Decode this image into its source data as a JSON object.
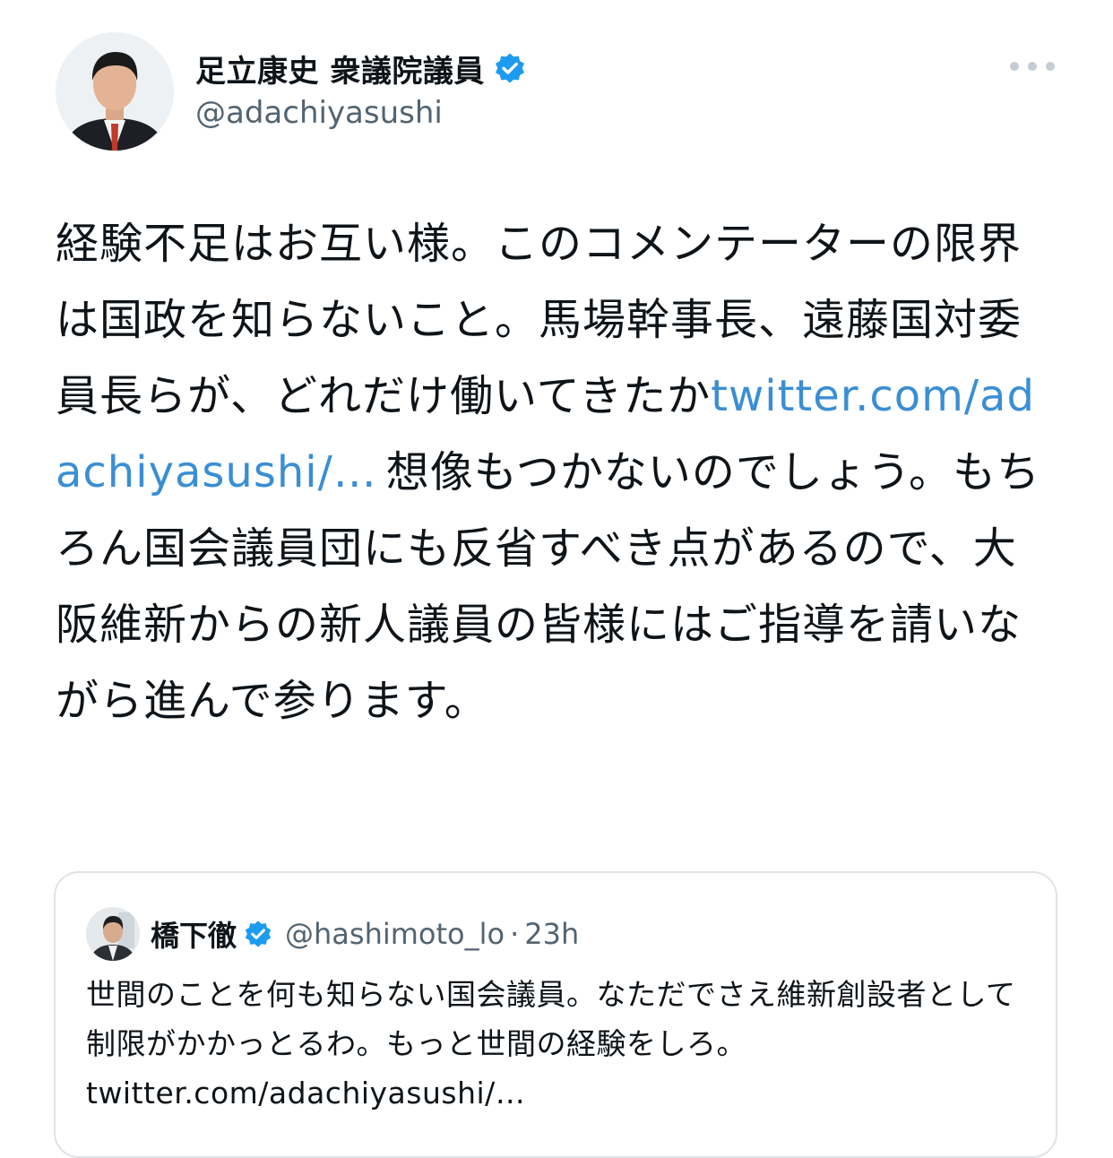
{
  "tweet": {
    "author": {
      "name": "足立康史 衆議院議員",
      "handle": "@adachiyasushi",
      "verified": true
    },
    "text_before_link": "経験不足はお互い様。このコメンテーターの限界は国政を知らないこと。馬場幹事長、遠藤国対委員長らが、どれだけ働いてきたか",
    "link": "twitter.com/adachiyasushi/…",
    "text_after_link": "想像もつかないのでしょう。もちろん国会議員団にも反省すべき点があるので、大阪維新からの新人議員の皆様にはご指導を請いながら進んで参ります。"
  },
  "quoted_tweet": {
    "author": {
      "name": "橋下徹",
      "handle": "@hashimoto_lo",
      "verified": true
    },
    "separator": "·",
    "time": "23h",
    "text": "世間のことを何も知らない国会議員。なただでさえ維新創設者として制限がかかっとるわ。もっと世間の経験をしろ。",
    "link": "twitter.com/adachiyasushi/…"
  },
  "colors": {
    "verified": "#1d9bf0",
    "link": "#3a8ed4",
    "secondary_text": "#536471",
    "card_border": "#dfe3e7"
  },
  "icons": {
    "verified": "verified-badge-icon",
    "more": "more-options-icon"
  }
}
